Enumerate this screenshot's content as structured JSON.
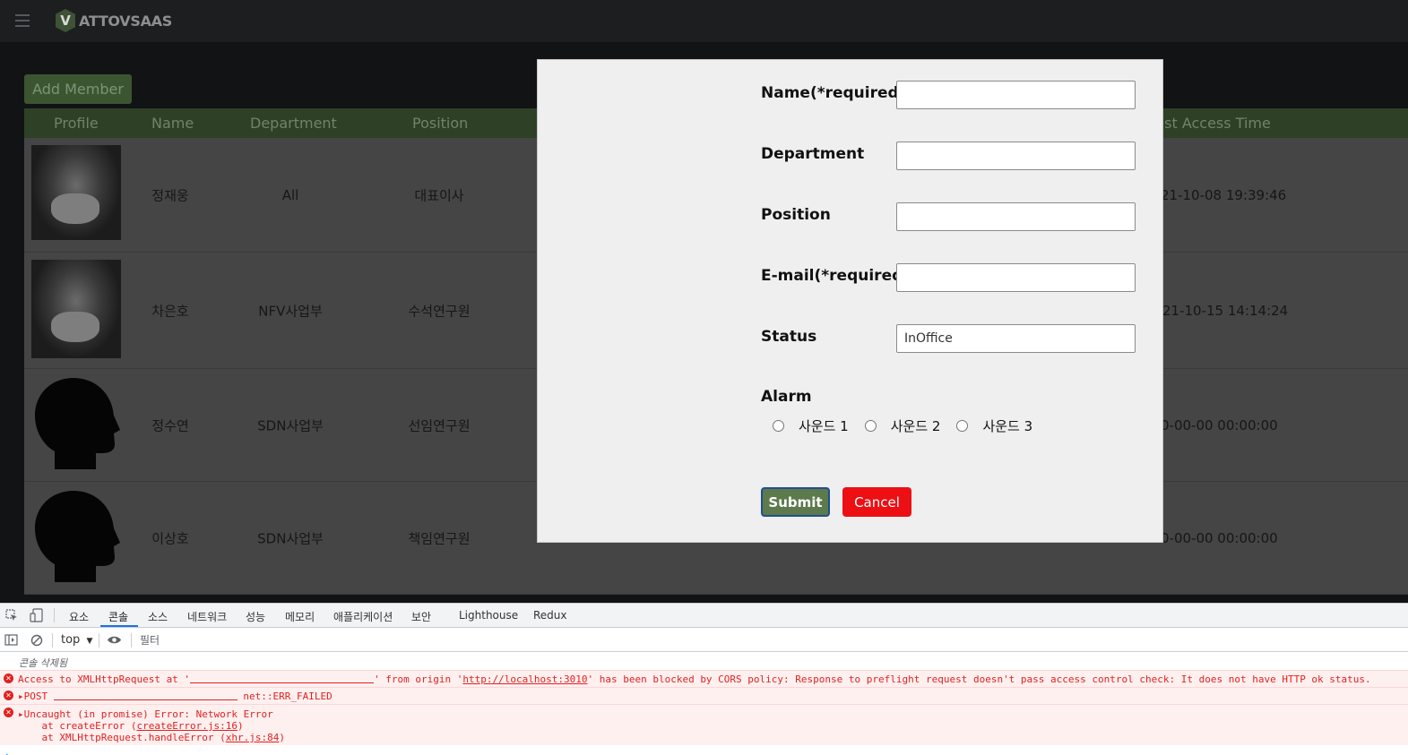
{
  "app": {
    "brand_badge": "V",
    "brand_name": "ATTOVSAAS",
    "add_member_label": "Add Member"
  },
  "table": {
    "columns": [
      "Profile",
      "Name",
      "Department",
      "Position",
      "test Access Time"
    ],
    "rows": [
      {
        "name": "정재웅",
        "department": "All",
        "position": "대표이사",
        "access_time": "21-10-08 19:39:46",
        "avatar": "photo"
      },
      {
        "name": "차은호",
        "department": "NFV사업부",
        "position": "수석연구원",
        "access_time": "21-10-15 14:14:24",
        "avatar": "photo"
      },
      {
        "name": "정수연",
        "department": "SDN사업부",
        "position": "선임연구원",
        "access_time": "0-00-00 00:00:00",
        "avatar": "silhouette"
      },
      {
        "name": "이상호",
        "department": "SDN사업부",
        "position": "책임연구원",
        "access_time": "0-00-00 00:00:00",
        "avatar": "silhouette"
      }
    ]
  },
  "modal": {
    "name_label": "Name(*required)",
    "name_value": "",
    "department_label": "Department",
    "department_value": "",
    "position_label": "Position",
    "position_value": "",
    "email_label": "E-mail(*required)",
    "email_value": "",
    "status_label": "Status",
    "status_value": "InOffice",
    "alarm_label": "Alarm",
    "alarm_options": [
      "사운드 1",
      "사운드 2",
      "사운드 3"
    ],
    "submit_label": "Submit",
    "cancel_label": "Cancel"
  },
  "devtools": {
    "tabs": [
      "요소",
      "콘솔",
      "소스",
      "네트워크",
      "성능",
      "메모리",
      "애플리케이션",
      "보안",
      "Lighthouse",
      "Redux"
    ],
    "active_tab": "콘솔",
    "context": "top",
    "filter_placeholder": "필터",
    "cleared_message": "콘솔 삭제됨",
    "errors": {
      "cors_prefix": "Access to XMLHttpRequest at '",
      "cors_mid": "' from origin '",
      "cors_origin": "http://localhost:3010",
      "cors_suffix": "' has been blocked by CORS policy: Response to preflight request doesn't pass access control check: It does not have HTTP ok status.",
      "post_prefix": "POST ",
      "post_suffix": " net::ERR_FAILED",
      "uncaught": "Uncaught (in promise) Error: Network Error",
      "stack1_prefix": "    at createError (",
      "stack1_link": "createError.js:16",
      "stack1_suffix": ")",
      "stack2_prefix": "    at XMLHttpRequest.handleError (",
      "stack2_link": "xhr.js:84",
      "stack2_suffix": ")"
    }
  },
  "colors": {
    "header_green": "#2e4126",
    "submit_green": "#5c7a4c",
    "cancel_red": "#ec0f14",
    "error_red": "#e0221f"
  }
}
